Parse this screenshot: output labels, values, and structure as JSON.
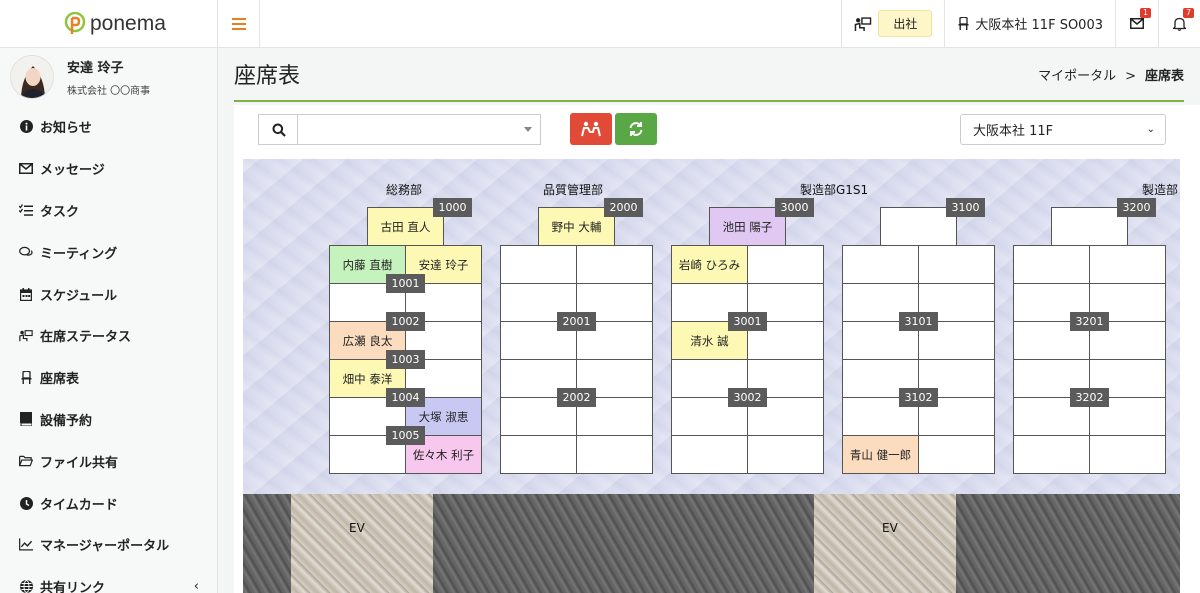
{
  "app": {
    "name": "ponema"
  },
  "user": {
    "name": "安達 玲子",
    "company": "株式会社 〇〇商事"
  },
  "menu": [
    {
      "label": "お知らせ",
      "icon": "info-icon"
    },
    {
      "label": "メッセージ",
      "icon": "envelope-icon"
    },
    {
      "label": "タスク",
      "icon": "tasks-icon"
    },
    {
      "label": "ミーティング",
      "icon": "chat-icon"
    },
    {
      "label": "スケジュール",
      "icon": "calendar-icon"
    },
    {
      "label": "在席ステータス",
      "icon": "presence-icon"
    },
    {
      "label": "座席表",
      "icon": "seat-icon"
    },
    {
      "label": "設備予約",
      "icon": "book-icon"
    },
    {
      "label": "ファイル共有",
      "icon": "folder-icon"
    },
    {
      "label": "タイムカード",
      "icon": "clock-icon"
    },
    {
      "label": "マネージャーポータル",
      "icon": "chart-icon"
    },
    {
      "label": "共有リンク",
      "icon": "globe-icon"
    }
  ],
  "topbar": {
    "status_label": "出社",
    "location_label": "大阪本社 11F SO003",
    "messages_badge": "1",
    "notifications_badge": "7"
  },
  "page": {
    "title": "座席表",
    "breadcrumb_home": "マイポータル",
    "breadcrumb_sep": ">",
    "breadcrumb_current": "座席表"
  },
  "toolbar": {
    "search_value": "",
    "floor_selected": "大阪本社 11F"
  },
  "map": {
    "departments": [
      "総務部",
      "品質管理部",
      "製造部G1S1",
      "製造部"
    ],
    "seat_numbers": [
      "1000",
      "1001",
      "1002",
      "1003",
      "1004",
      "1005",
      "2000",
      "2001",
      "2002",
      "3000",
      "3001",
      "3002",
      "3100",
      "3101",
      "3102",
      "3200",
      "3201",
      "3202"
    ],
    "occupants": {
      "seat_1000": "古田 直人",
      "seat_naito": "内藤 直樹",
      "seat_adachi": "安達 玲子",
      "seat_hirose": "広瀬 良太",
      "seat_hatanaka": "畑中 泰洋",
      "seat_otsuka": "大塚 淑恵",
      "seat_sasaki": "佐々木 利子",
      "seat_2000": "野中 大輔",
      "seat_3000": "池田 陽子",
      "seat_iwasaki": "岩崎 ひろみ",
      "seat_shimizu": "清水 誠",
      "seat_aoyama": "青山 健一郎"
    },
    "colors": {
      "yellow": "#fdf9b4",
      "green": "#c6f2bd",
      "orange": "#fcdcbf",
      "blue": "#c8c8f3",
      "pink": "#f8c7ee",
      "purple": "#e0c8f2"
    },
    "ev_labels": [
      "EV",
      "EV"
    ]
  }
}
